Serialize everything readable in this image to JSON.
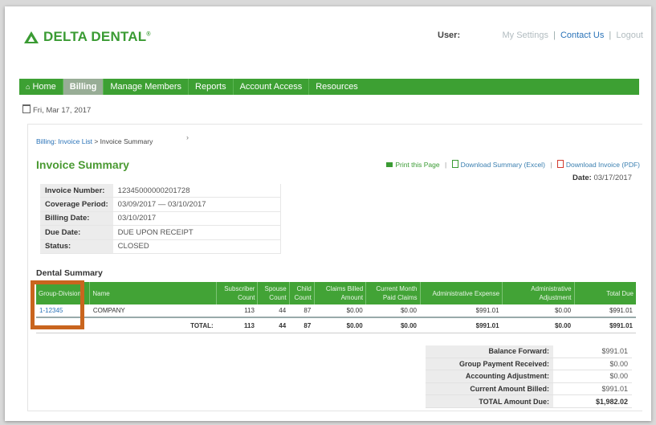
{
  "brand": {
    "logo_text": "DELTA DENTAL",
    "logo_mark": "®"
  },
  "header": {
    "user_label": "User:",
    "my_settings": "My Settings",
    "contact_us": "Contact Us",
    "logout": "Logout",
    "separator": "|"
  },
  "nav": {
    "home_icon": "⌂",
    "items": [
      {
        "label": "Home"
      },
      {
        "label": "Billing"
      },
      {
        "label": "Manage Members"
      },
      {
        "label": "Reports"
      },
      {
        "label": "Account Access"
      },
      {
        "label": "Resources"
      }
    ],
    "active_index": 1
  },
  "current_date": "Fri, Mar 17, 2017",
  "breadcrumb": {
    "billing": "Billing",
    "invoice_list": "Invoice List",
    "arrow": ">",
    "current": "Invoice Summary"
  },
  "page_title": "Invoice Summary",
  "actions": {
    "print": "Print this Page",
    "download_summary": "Download Summary (Excel)",
    "download_invoice": "Download Invoice (PDF)",
    "separator": "|"
  },
  "date_right": {
    "label": "Date:",
    "value": "03/17/2017"
  },
  "invoice_info": [
    {
      "label": "Invoice Number:",
      "value": "12345000000201728"
    },
    {
      "label": "Coverage Period:",
      "value": "03/09/2017 — 03/10/2017"
    },
    {
      "label": "Billing Date:",
      "value": "03/10/2017"
    },
    {
      "label": "Due Date:",
      "value": "DUE UPON RECEIPT"
    },
    {
      "label": "Status:",
      "value": "CLOSED"
    }
  ],
  "dental_summary": {
    "title": "Dental Summary",
    "headers": {
      "group_division": "Group-Division",
      "name": "Name",
      "subscriber_count": "Subscriber Count",
      "spouse_count": "Spouse Count",
      "child_count": "Child Count",
      "claims_billed": "Claims Billed Amount",
      "current_month_paid": "Current Month Paid Claims",
      "admin_expense": "Administrative Expense",
      "admin_adjustment": "Administrative Adjustment",
      "total_due": "Total Due"
    },
    "row": {
      "group_division": "1-12345",
      "name": "COMPANY",
      "subscriber_count": "113",
      "spouse_count": "44",
      "child_count": "87",
      "claims_billed": "$0.00",
      "current_month_paid": "$0.00",
      "admin_expense": "$991.01",
      "admin_adjustment": "$0.00",
      "total_due": "$991.01"
    },
    "total": {
      "label": "TOTAL:",
      "subscriber_count": "113",
      "spouse_count": "44",
      "child_count": "87",
      "claims_billed": "$0.00",
      "current_month_paid": "$0.00",
      "admin_expense": "$991.01",
      "admin_adjustment": "$0.00",
      "total_due": "$991.01"
    }
  },
  "balance_summary": [
    {
      "label": "Balance Forward:",
      "value": "$991.01"
    },
    {
      "label": "Group Payment Received:",
      "value": "$0.00"
    },
    {
      "label": "Accounting Adjustment:",
      "value": "$0.00"
    },
    {
      "label": "Current Amount Billed:",
      "value": "$991.01"
    },
    {
      "label": "TOTAL Amount Due:",
      "value": "$1,982.02"
    }
  ],
  "colors": {
    "brand_green": "#3a9b33",
    "nav_green": "#3da033",
    "link_blue": "#2a73b8",
    "highlight_orange": "#c9651e"
  }
}
